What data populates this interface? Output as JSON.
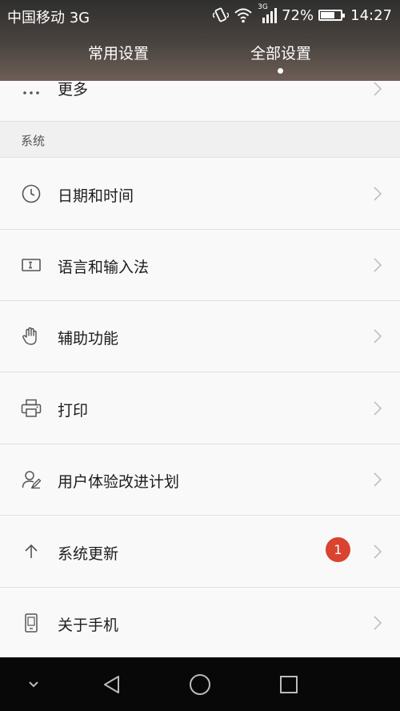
{
  "status_bar": {
    "carrier": "中国移动 3G",
    "network_badge": "3G",
    "battery_percent": "72%",
    "battery_level": 0.72,
    "time": "14:27",
    "icons": [
      "vibrate-icon",
      "wifi-icon",
      "signal-icon",
      "battery-icon"
    ]
  },
  "tabs": [
    {
      "label": "常用设置",
      "active": false
    },
    {
      "label": "全部设置",
      "active": true
    }
  ],
  "list": {
    "partial_item": {
      "label": "更多",
      "icon": "more-dots-icon"
    },
    "section_title": "系统",
    "items": [
      {
        "label": "日期和时间",
        "icon": "clock-icon"
      },
      {
        "label": "语言和输入法",
        "icon": "keyboard-icon"
      },
      {
        "label": "辅助功能",
        "icon": "hand-icon"
      },
      {
        "label": "打印",
        "icon": "printer-icon"
      },
      {
        "label": "用户体验改进计划",
        "icon": "user-feedback-icon"
      },
      {
        "label": "系统更新",
        "icon": "arrow-up-icon",
        "badge": "1"
      },
      {
        "label": "关于手机",
        "icon": "phone-icon"
      }
    ]
  },
  "nav_bar": {
    "buttons": [
      "hide-nav-icon",
      "back-icon",
      "home-icon",
      "recents-icon"
    ]
  },
  "colors": {
    "badge": "#d9432f",
    "icon_stroke": "#555555",
    "chevron": "#c0c0c0",
    "header_top": "#2f2f2f",
    "header_bottom": "#6e5e56"
  }
}
